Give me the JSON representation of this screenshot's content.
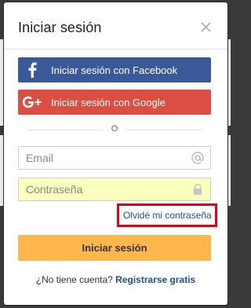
{
  "modal": {
    "title": "Iniciar sesión",
    "close_icon": "close-icon"
  },
  "social": {
    "facebook_label": "Iniciar sesión con Facebook",
    "facebook_icon": "facebook-icon",
    "facebook_color": "#3b5998",
    "google_label": "Iniciar sesión con Google",
    "google_icon": "google-plus-icon",
    "google_color": "#dc4e41"
  },
  "divider_text": "O",
  "form": {
    "email_placeholder": "Email",
    "email_value": "",
    "email_icon": "at-sign-icon",
    "password_placeholder": "Contraseña",
    "password_value": "",
    "password_icon": "lock-icon",
    "password_autofill_color": "#faffbd",
    "forgot_label": "Olvidé mi contraseña",
    "forgot_highlight_color": "#e0001a",
    "submit_label": "Iniciar sesión",
    "submit_color": "#ffb74d"
  },
  "signup": {
    "prompt": "¿No tiene cuenta?",
    "link_label": "Registrarse gratis"
  }
}
